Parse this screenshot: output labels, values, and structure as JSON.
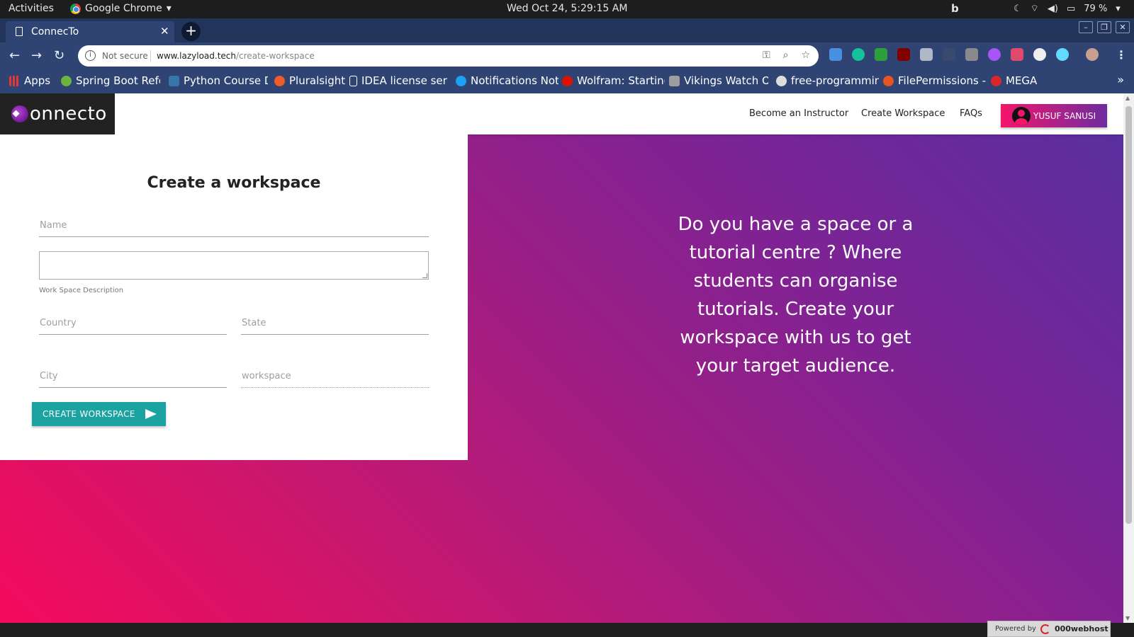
{
  "os": {
    "activities": "Activities",
    "app_name": "Google Chrome",
    "clock": "Wed Oct 24,  5:29:15 AM",
    "battery": "79 %"
  },
  "browser": {
    "tab_title": "ConnecTo",
    "security_label": "Not secure",
    "url_host": "www.lazyload.tech",
    "url_path": "/create-workspace",
    "bookmarks": [
      {
        "label": "Apps",
        "color": "#e53935"
      },
      {
        "label": "Spring Boot Refe",
        "color": "#6db33f"
      },
      {
        "label": "Python Course D",
        "color": "#3776ab"
      },
      {
        "label": "Pluralsight",
        "color": "#f15b2a"
      },
      {
        "label": "IDEA license ser",
        "color": "#ffffff"
      },
      {
        "label": "Notifications Noti",
        "color": "#1da1f2"
      },
      {
        "label": "Wolfram: Starting",
        "color": "#dd1100"
      },
      {
        "label": "Vikings Watch O",
        "color": "#9e9e9e"
      },
      {
        "label": "free-programming",
        "color": "#ffffff"
      },
      {
        "label": "FilePermissions -",
        "color": "#e95420"
      },
      {
        "label": "MEGA",
        "color": "#d9272e"
      }
    ]
  },
  "site": {
    "brand": "onnecto",
    "nav": {
      "instructor": "Become an Instructor",
      "create_workspace": "Create Workspace",
      "faqs": "FAQs"
    },
    "user_name": "YUSUF SANUSI",
    "form": {
      "title": "Create a workspace",
      "name_placeholder": "Name",
      "description_helper": "Work Space Description",
      "country_placeholder": "Country",
      "state_placeholder": "State",
      "city_placeholder": "City",
      "workspace_placeholder": "workspace",
      "submit_label": "CREATE WORKSPACE"
    },
    "promo_text": "Do you have a space or a tutorial centre ? Where students can organise tutorials. Create your workspace with us to get your target audience.",
    "powered_by": "Powered by",
    "host_name": "000webhost"
  },
  "colors": {
    "accent_teal": "#1aa3a0",
    "gradient_pink": "#f50a5c",
    "gradient_purple": "#5630a0"
  }
}
